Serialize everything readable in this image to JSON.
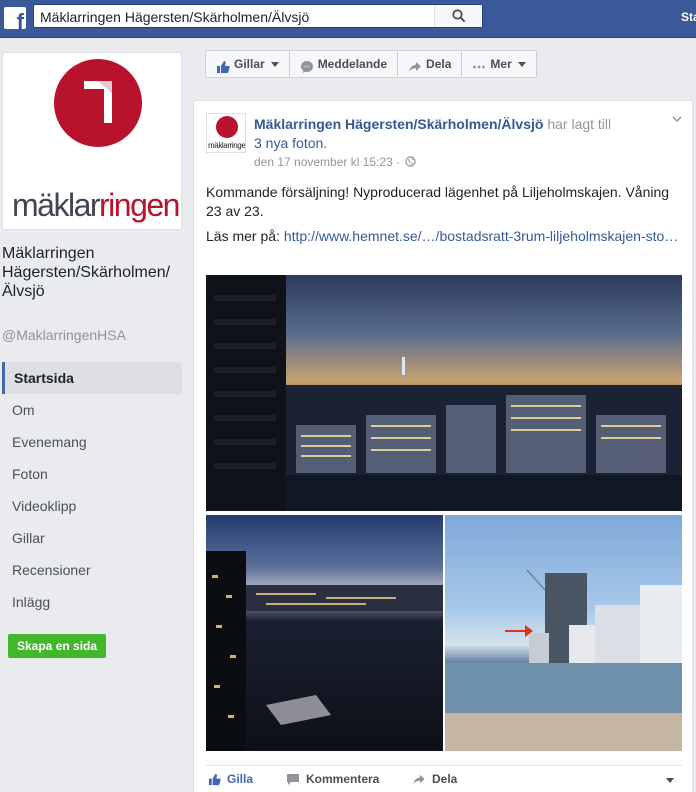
{
  "topbar": {
    "search_value": "Mäklarringen Hägersten/Skärholmen/Älvsjö",
    "link_label": "Star"
  },
  "profile": {
    "logo_text_part1": "mäklar",
    "logo_text_part2": "ringen",
    "page_name": "Mäklarringen Hägersten/Skärholmen/Älvsjö",
    "handle": "@MaklarringenHSA"
  },
  "left_nav": {
    "items": [
      {
        "label": "Startsida"
      },
      {
        "label": "Om"
      },
      {
        "label": "Evenemang"
      },
      {
        "label": "Foton"
      },
      {
        "label": "Videoklipp"
      },
      {
        "label": "Gillar"
      },
      {
        "label": "Recensioner"
      },
      {
        "label": "Inlägg"
      }
    ],
    "create_page_label": "Skapa en sida"
  },
  "action_bar": {
    "like_label": "Gillar",
    "message_label": "Meddelande",
    "share_label": "Dela",
    "more_label": "Mer"
  },
  "post": {
    "avatar_text": "mäklarringen",
    "author": "Mäklarringen Hägersten/Skärholmen/Älvsjö",
    "action": "har lagt till",
    "photos_link": "3 nya foton.",
    "timestamp": "den 17 november kl 15:23 ·",
    "text": "Kommande försäljning! Nyproducerad lägenhet på Liljeholmskajen. Våning 23 av 23.",
    "more_label": "Läs mer på:",
    "more_link": "http://www.hemnet.se/…/bostadsratt-3rum-liljeholmskajen-sto…",
    "footer": {
      "like_label": "Gilla",
      "comment_label": "Kommentera",
      "share_label": "Dela"
    }
  },
  "colors": {
    "facebook_blue": "#3b5998",
    "link_blue": "#365899",
    "brand_red": "#b9122d",
    "green_button": "#42b72a"
  }
}
